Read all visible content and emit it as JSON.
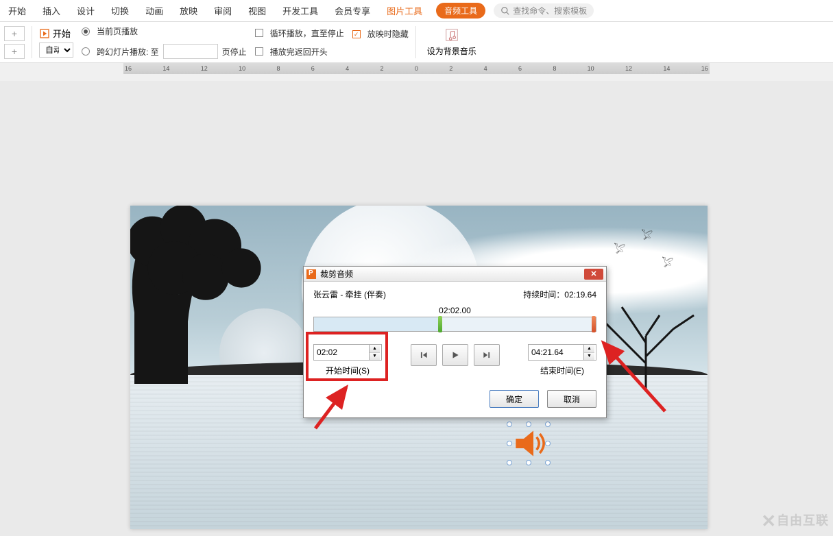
{
  "tabs": {
    "t0": "开始",
    "t1": "插入",
    "t2": "设计",
    "t3": "切换",
    "t4": "动画",
    "t5": "放映",
    "t6": "审阅",
    "t7": "视图",
    "t8": "开发工具",
    "t9": "会员专享",
    "pictool": "图片工具",
    "audiotool": "音频工具"
  },
  "search": {
    "placeholder": "查找命令、搜索模板"
  },
  "ribbon": {
    "plus": "+",
    "startbtn": "开始",
    "auto_value": "自动",
    "radio_curpage": "当前页播放",
    "radio_cross": "跨幻灯片播放: 至",
    "chk_loop": "循环播放，直至停止",
    "chk_hide": "放映时隐藏",
    "pagestop": "页停止",
    "chk_return": "播放完返回开头",
    "bgmusic": "设为背景音乐"
  },
  "ruler": [
    "16",
    "14",
    "12",
    "10",
    "8",
    "6",
    "4",
    "2",
    "0",
    "2",
    "4",
    "6",
    "8",
    "10",
    "12",
    "14",
    "16"
  ],
  "dialog": {
    "title": "裁剪音频",
    "trackname": "张云雷 - 牵挂 (伴奏)",
    "duration_label": "持续时间：",
    "duration": "02:19.64",
    "pos_label": "02:02.00",
    "start_value": "02:02",
    "start_label": "开始时间(S)",
    "end_value": "04:21.64",
    "end_label": "结束时间(E)",
    "ok": "确定",
    "cancel": "取消"
  },
  "watermark": "自由互联"
}
